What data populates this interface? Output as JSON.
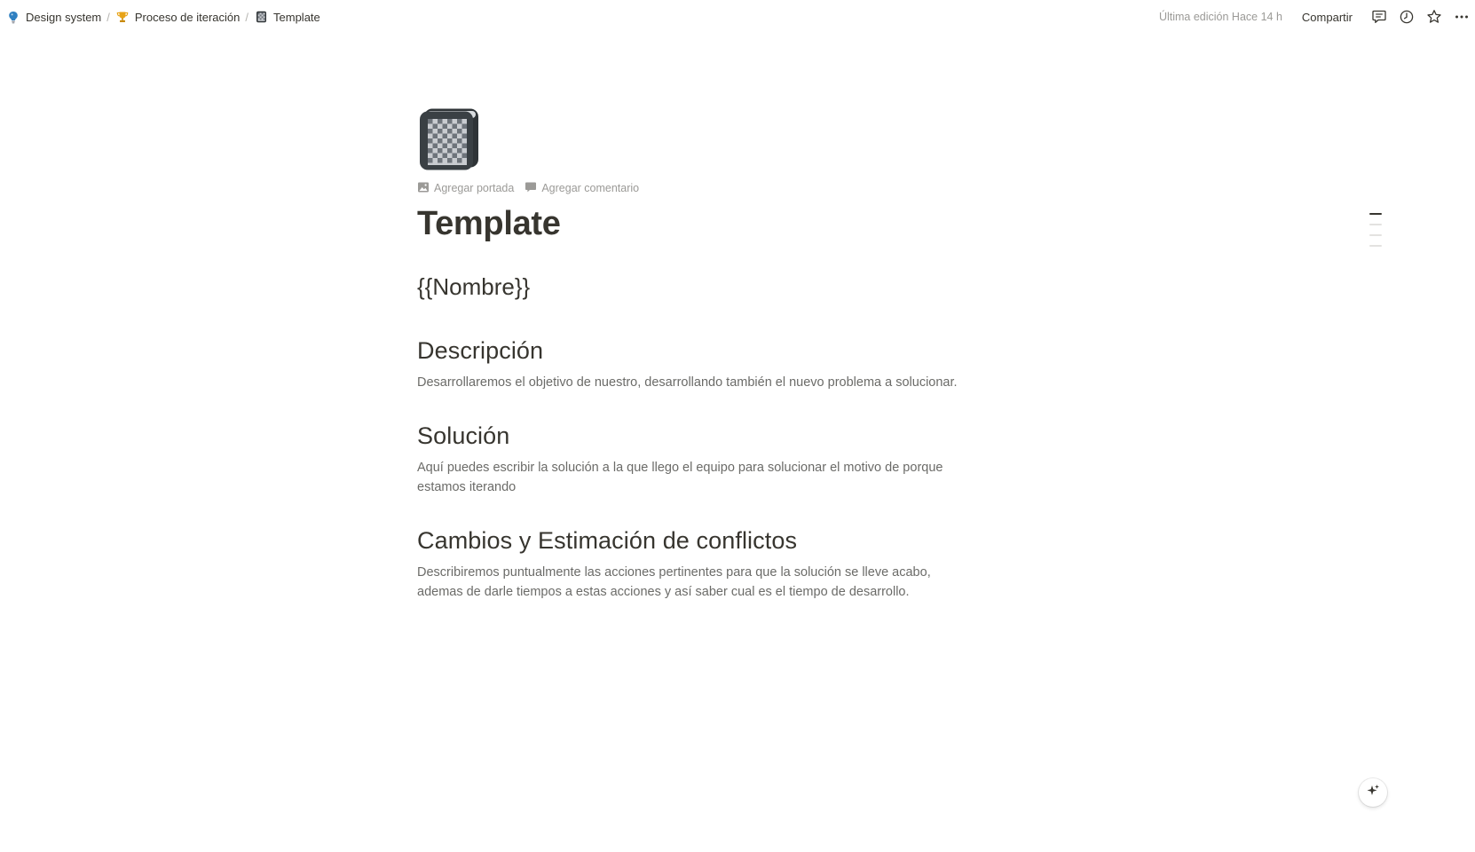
{
  "breadcrumb": {
    "items": [
      {
        "label": "Design system",
        "icon": "lightbulb-icon"
      },
      {
        "label": "Proceso de iteración",
        "icon": "trophy-icon"
      },
      {
        "label": "Template",
        "icon": "notebook-icon"
      }
    ],
    "separator": "/"
  },
  "topbar": {
    "last_edit": "Última edición Hace 14 h",
    "share_label": "Compartir",
    "icons": [
      "comments-icon",
      "history-icon",
      "star-icon",
      "more-icon"
    ]
  },
  "page": {
    "icon": "notebook-icon",
    "controls": {
      "add_cover": "Agregar portada",
      "add_comment": "Agregar comentario"
    },
    "title": "Template",
    "name_placeholder": "{{Nombre}}",
    "sections": [
      {
        "heading": "Descripción",
        "body": "Desarrollaremos el objetivo de nuestro, desarrollando también el nuevo problema a solucionar."
      },
      {
        "heading": "Solución",
        "body": "Aquí puedes escribir la solución a la que llego el equipo para solucionar el motivo de porque estamos iterando"
      },
      {
        "heading": "Cambios y Estimación de conflictos",
        "body": "Describiremos puntualmente las acciones pertinentes para que la solución se lleve acabo, ademas de darle tiempos a estas acciones y así saber cual es el tiempo de desarrollo."
      }
    ]
  },
  "outline": {
    "marks": 4,
    "active_index": 0
  },
  "colors": {
    "text": "#37352f",
    "muted": "#9b9a97",
    "body": "#6b6b68",
    "lightbulb": "#2f80c1",
    "trophy": "#e8a317"
  },
  "ai_button": {
    "icon": "sparkle-icon"
  }
}
